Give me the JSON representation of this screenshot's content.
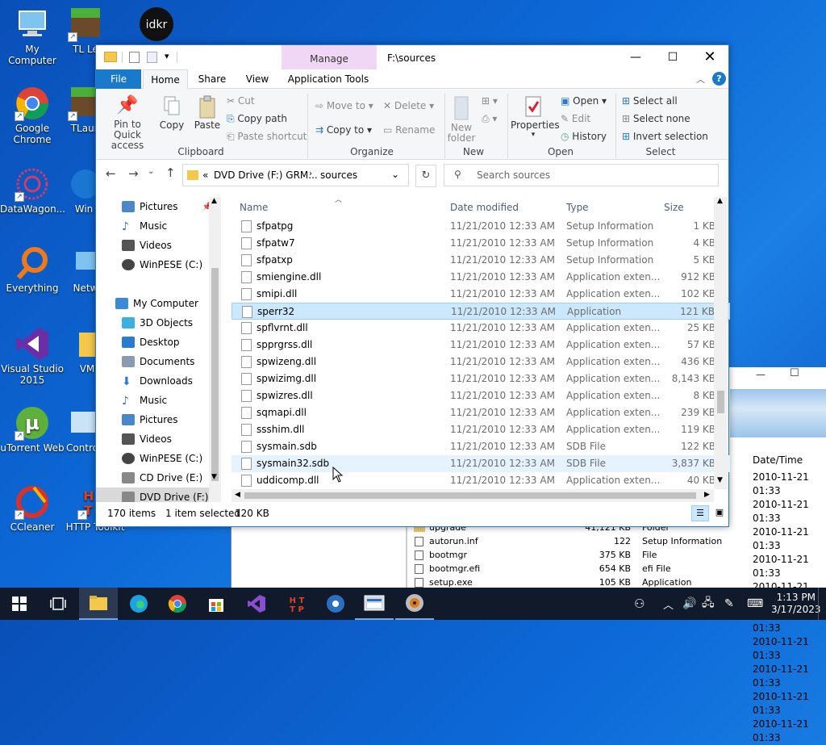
{
  "desktop": {
    "icons": [
      {
        "label": "My Computer"
      },
      {
        "label": "TL Le"
      },
      {
        "label": "idkr"
      },
      {
        "label": "Google Chrome"
      },
      {
        "label": "TLaun"
      },
      {
        "label": "DataWagon..."
      },
      {
        "label": "Win"
      },
      {
        "label": "Everything"
      },
      {
        "label": "Netw"
      },
      {
        "label": "Visual Studio 2015"
      },
      {
        "label": "VM"
      },
      {
        "label": "uTorrent Web"
      },
      {
        "label": "Contro"
      },
      {
        "label": "CCleaner"
      },
      {
        "label": "HTTP Toolkit"
      }
    ]
  },
  "background_window": {
    "column_header": "Date/Time",
    "left_row": "upgrade",
    "dates": [
      "2010-11-21 01:33",
      "2010-11-21 01:33",
      "2010-11-21 01:33",
      "2010-11-21 01:33",
      "2010-11-21 01:33",
      "2010-11-21 01:33",
      "2010-11-21 01:33",
      "2010-11-21 01:33",
      "2010-11-21 01:33",
      "2010-11-21 01:33"
    ],
    "rows": [
      {
        "name": "upgrade",
        "size": "41,121 KB",
        "type": "Folder"
      },
      {
        "name": "autorun.inf",
        "size": "122",
        "type": "Setup Information"
      },
      {
        "name": "bootmgr",
        "size": "375 KB",
        "type": "File"
      },
      {
        "name": "bootmgr.efi",
        "size": "654 KB",
        "type": "efi File"
      },
      {
        "name": "setup.exe",
        "size": "105 KB",
        "type": "Application"
      }
    ]
  },
  "window": {
    "title": "F:\\sources",
    "context_tab": "Manage",
    "tabs": [
      "File",
      "Home",
      "Share",
      "View",
      "Application Tools"
    ],
    "ribbon": {
      "pin": "Pin to Quick access",
      "copy": "Copy",
      "paste": "Paste",
      "cut": "Cut",
      "copy_path": "Copy path",
      "paste_shortcut": "Paste shortcut",
      "clipboard": "Clipboard",
      "move_to": "Move to",
      "copy_to": "Copy to",
      "delete": "Delete",
      "rename": "Rename",
      "organize": "Organize",
      "new_folder": "New folder",
      "new": "New",
      "properties": "Properties",
      "open": "Open",
      "edit": "Edit",
      "history": "History",
      "open_group": "Open",
      "select_all": "Select all",
      "select_none": "Select none",
      "invert_selection": "Invert selection",
      "select_group": "Select"
    },
    "address": {
      "prefix": "«",
      "crumb1": "DVD Drive (F:) GRM...",
      "crumb2": "sources",
      "search_placeholder": "Search sources"
    },
    "nav": [
      {
        "label": "Pictures",
        "color": "#4a87c9"
      },
      {
        "label": "Music",
        "color": "#2a6fc0"
      },
      {
        "label": "Videos",
        "color": "#555555"
      },
      {
        "label": "WinPESE (C:)",
        "color": "#444444"
      },
      {
        "label": "",
        "color": ""
      },
      {
        "label": "My Computer",
        "color": "#3a8ad8"
      },
      {
        "label": "3D Objects",
        "color": "#3ab0e0"
      },
      {
        "label": "Desktop",
        "color": "#2a7ad0"
      },
      {
        "label": "Documents",
        "color": "#8a9ab0"
      },
      {
        "label": "Downloads",
        "color": "#2a7ad0"
      },
      {
        "label": "Music",
        "color": "#2a6fc0"
      },
      {
        "label": "Pictures",
        "color": "#4a87c9"
      },
      {
        "label": "Videos",
        "color": "#555555"
      },
      {
        "label": "WinPESE (C:)",
        "color": "#444444"
      },
      {
        "label": "CD Drive (E:)",
        "color": "#888888"
      },
      {
        "label": "DVD Drive (F:) GI",
        "color": "#888888"
      }
    ],
    "columns": {
      "name": "Name",
      "date": "Date modified",
      "type": "Type",
      "size": "Size"
    },
    "files": [
      {
        "name": "sfpatpg",
        "date": "11/21/2010 12:33 AM",
        "type": "Setup Information",
        "size": "1 KB"
      },
      {
        "name": "sfpatw7",
        "date": "11/21/2010 12:33 AM",
        "type": "Setup Information",
        "size": "4 KB"
      },
      {
        "name": "sfpatxp",
        "date": "11/21/2010 12:33 AM",
        "type": "Setup Information",
        "size": "5 KB"
      },
      {
        "name": "smiengine.dll",
        "date": "11/21/2010 12:33 AM",
        "type": "Application exten...",
        "size": "912 KB"
      },
      {
        "name": "smipi.dll",
        "date": "11/21/2010 12:33 AM",
        "type": "Application exten...",
        "size": "102 KB"
      },
      {
        "name": "sperr32",
        "date": "11/21/2010 12:33 AM",
        "type": "Application",
        "size": "121 KB"
      },
      {
        "name": "spflvrnt.dll",
        "date": "11/21/2010 12:33 AM",
        "type": "Application exten...",
        "size": "25 KB"
      },
      {
        "name": "spprgrss.dll",
        "date": "11/21/2010 12:33 AM",
        "type": "Application exten...",
        "size": "57 KB"
      },
      {
        "name": "spwizeng.dll",
        "date": "11/21/2010 12:33 AM",
        "type": "Application exten...",
        "size": "436 KB"
      },
      {
        "name": "spwizimg.dll",
        "date": "11/21/2010 12:33 AM",
        "type": "Application exten...",
        "size": "8,143 KB"
      },
      {
        "name": "spwizres.dll",
        "date": "11/21/2010 12:33 AM",
        "type": "Application exten...",
        "size": "8 KB"
      },
      {
        "name": "sqmapi.dll",
        "date": "11/21/2010 12:33 AM",
        "type": "Application exten...",
        "size": "239 KB"
      },
      {
        "name": "ssshim.dll",
        "date": "11/21/2010 12:33 AM",
        "type": "Application exten...",
        "size": "119 KB"
      },
      {
        "name": "sysmain.sdb",
        "date": "11/21/2010 12:33 AM",
        "type": "SDB File",
        "size": "122 KB"
      },
      {
        "name": "sysmain32.sdb",
        "date": "11/21/2010 12:33 AM",
        "type": "SDB File",
        "size": "3,837 KB"
      },
      {
        "name": "uddicomp.dll",
        "date": "11/21/2010 12:33 AM",
        "type": "Application exten...",
        "size": "40 KB"
      }
    ],
    "status": {
      "count": "170 items",
      "selected": "1 item selected",
      "size": "120 KB"
    }
  },
  "taskbar": {
    "time": "1:13 PM",
    "date": "3/17/2023"
  },
  "colors": {
    "accent": "#0063b1",
    "selection": "#cce8ff",
    "taskbar": "#101a2a"
  }
}
